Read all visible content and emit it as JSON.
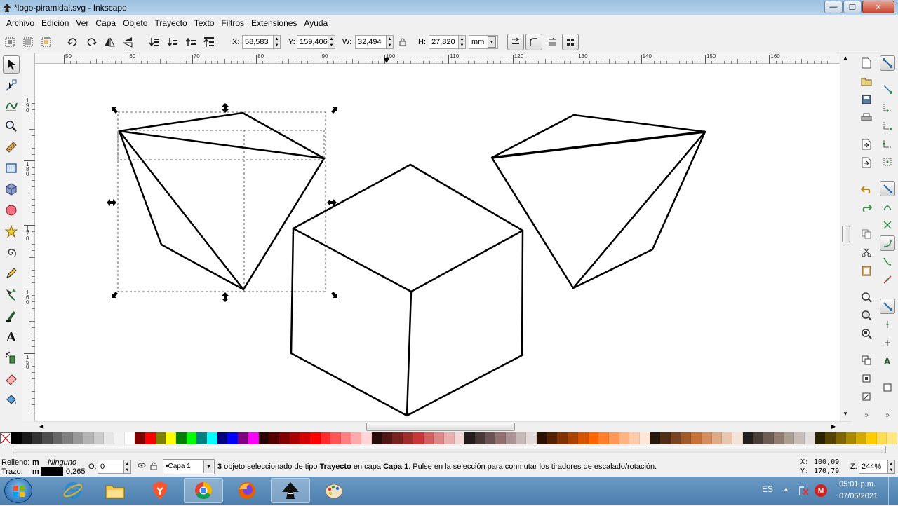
{
  "window": {
    "title": "*logo-piramidal.svg - Inkscape"
  },
  "menu": [
    "Archivo",
    "Edición",
    "Ver",
    "Capa",
    "Objeto",
    "Trayecto",
    "Texto",
    "Filtros",
    "Extensiones",
    "Ayuda"
  ],
  "toolbar": {
    "x_label": "X:",
    "x_value": "58,583",
    "y_label": "Y:",
    "y_value": "159,406",
    "w_label": "W:",
    "w_value": "32,494",
    "h_label": "H:",
    "h_value": "27,820",
    "unit": "mm"
  },
  "ruler": {
    "h_ticks": [
      "50",
      "60",
      "70",
      "80",
      "90",
      "100",
      "110",
      "120",
      "130",
      "140",
      "150",
      "160"
    ],
    "v_ticks": [
      "190",
      "180",
      "170",
      "160",
      "150"
    ]
  },
  "status": {
    "fill_label": "Relleno:",
    "fill_m": "m",
    "fill_value": "Ninguno",
    "stroke_label": "Trazo:",
    "stroke_m": "m",
    "stroke_width": "0,265",
    "opacity_label": "O:",
    "opacity_value": "0",
    "layer": "•Capa 1",
    "message_count": "3",
    "message_a": " objeto seleccionado de tipo ",
    "message_b": "Trayecto",
    "message_c": " en capa ",
    "message_d": "Capa 1",
    "message_e": ". Pulse en la selección para conmutar los tiradores de escalado/rotación.",
    "cursor_x_label": "X:",
    "cursor_x": "100,09",
    "cursor_y_label": "Y:",
    "cursor_y": "170,79",
    "zoom_label": "Z:",
    "zoom": "244%"
  },
  "taskbar": {
    "lang": "ES",
    "time": "05:01 p.m.",
    "date": "07/05/2021",
    "apps": [
      "start-orb",
      "internet-explorer",
      "brave-browser",
      "chrome",
      "firefox",
      "inkscape",
      "paint"
    ]
  },
  "palette_colors": [
    "#000000",
    "#1a1a1a",
    "#333333",
    "#4d4d4d",
    "#666666",
    "#808080",
    "#999999",
    "#b3b3b3",
    "#cccccc",
    "#e6e6e6",
    "#f2f2f2",
    "#ffffff",
    "#800000",
    "#ff0000",
    "#808000",
    "#ffff00",
    "#008000",
    "#00ff00",
    "#008080",
    "#00ffff",
    "#000080",
    "#0000ff",
    "#800080",
    "#ff00ff",
    "#2b0000",
    "#550000",
    "#800000",
    "#aa0000",
    "#d40000",
    "#ff0000",
    "#ff2a2a",
    "#ff5555",
    "#ff8080",
    "#ffaaaa",
    "#ffd5d5",
    "#280b0b",
    "#501616",
    "#782121",
    "#a02c2c",
    "#c83737",
    "#d35f5f",
    "#de8787",
    "#e9afaf",
    "#f4d7d7",
    "#241c1c",
    "#483737",
    "#6c5353",
    "#916f6f",
    "#ac9393",
    "#c8b7b7",
    "#e3dbdb",
    "#2b1100",
    "#552200",
    "#803300",
    "#aa4400",
    "#d45500",
    "#ff6600",
    "#ff7f2a",
    "#ff9955",
    "#ffb380",
    "#ffccaa",
    "#ffe6d5",
    "#28170b",
    "#502d16",
    "#784421",
    "#a05a2c",
    "#c87137",
    "#d38d5f",
    "#deaa87",
    "#e9c6af",
    "#f4e3d7",
    "#241f1c",
    "#483e37",
    "#6c5d53",
    "#917c6f",
    "#ac9d93",
    "#c8beb7",
    "#e3dedb",
    "#2b2200",
    "#554400",
    "#806600",
    "#aa8800",
    "#d4aa00",
    "#ffcc00",
    "#ffdd55",
    "#ffe680"
  ]
}
